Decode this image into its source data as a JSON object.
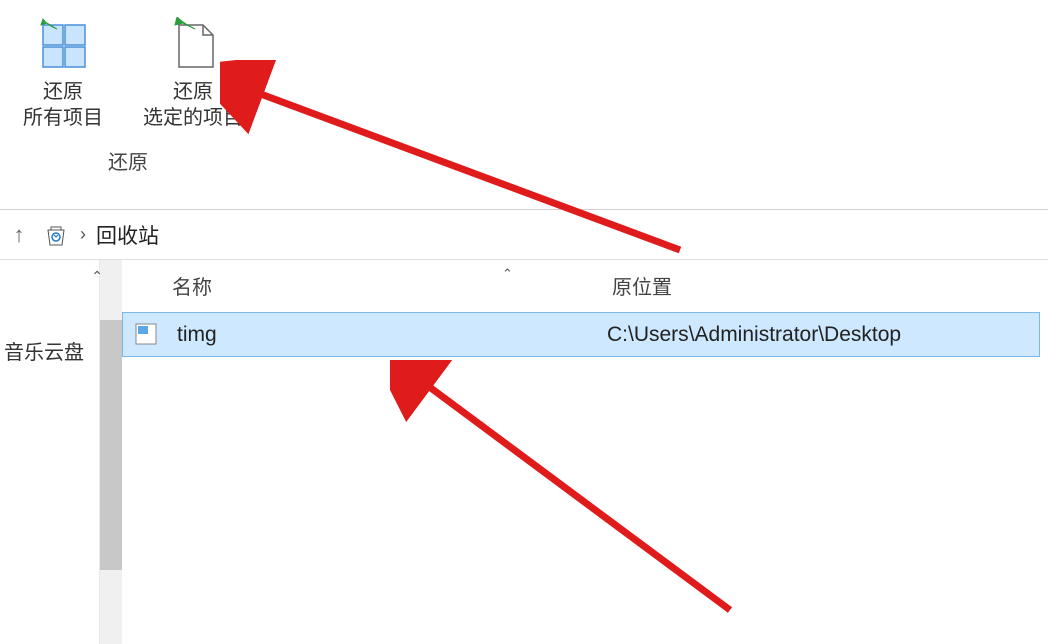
{
  "ribbon": {
    "buttons": [
      {
        "label_line1": "还原",
        "label_line2": "所有项目"
      },
      {
        "label_line1": "还原",
        "label_line2": "选定的项目"
      }
    ],
    "group_label": "还原"
  },
  "address_bar": {
    "location": "回收站",
    "separator": "›"
  },
  "sidebar": {
    "items": [
      {
        "label": "音乐云盘"
      }
    ]
  },
  "columns": {
    "name": "名称",
    "location": "原位置"
  },
  "files": [
    {
      "name": "timg",
      "original_location": "C:\\Users\\Administrator\\Desktop"
    }
  ]
}
